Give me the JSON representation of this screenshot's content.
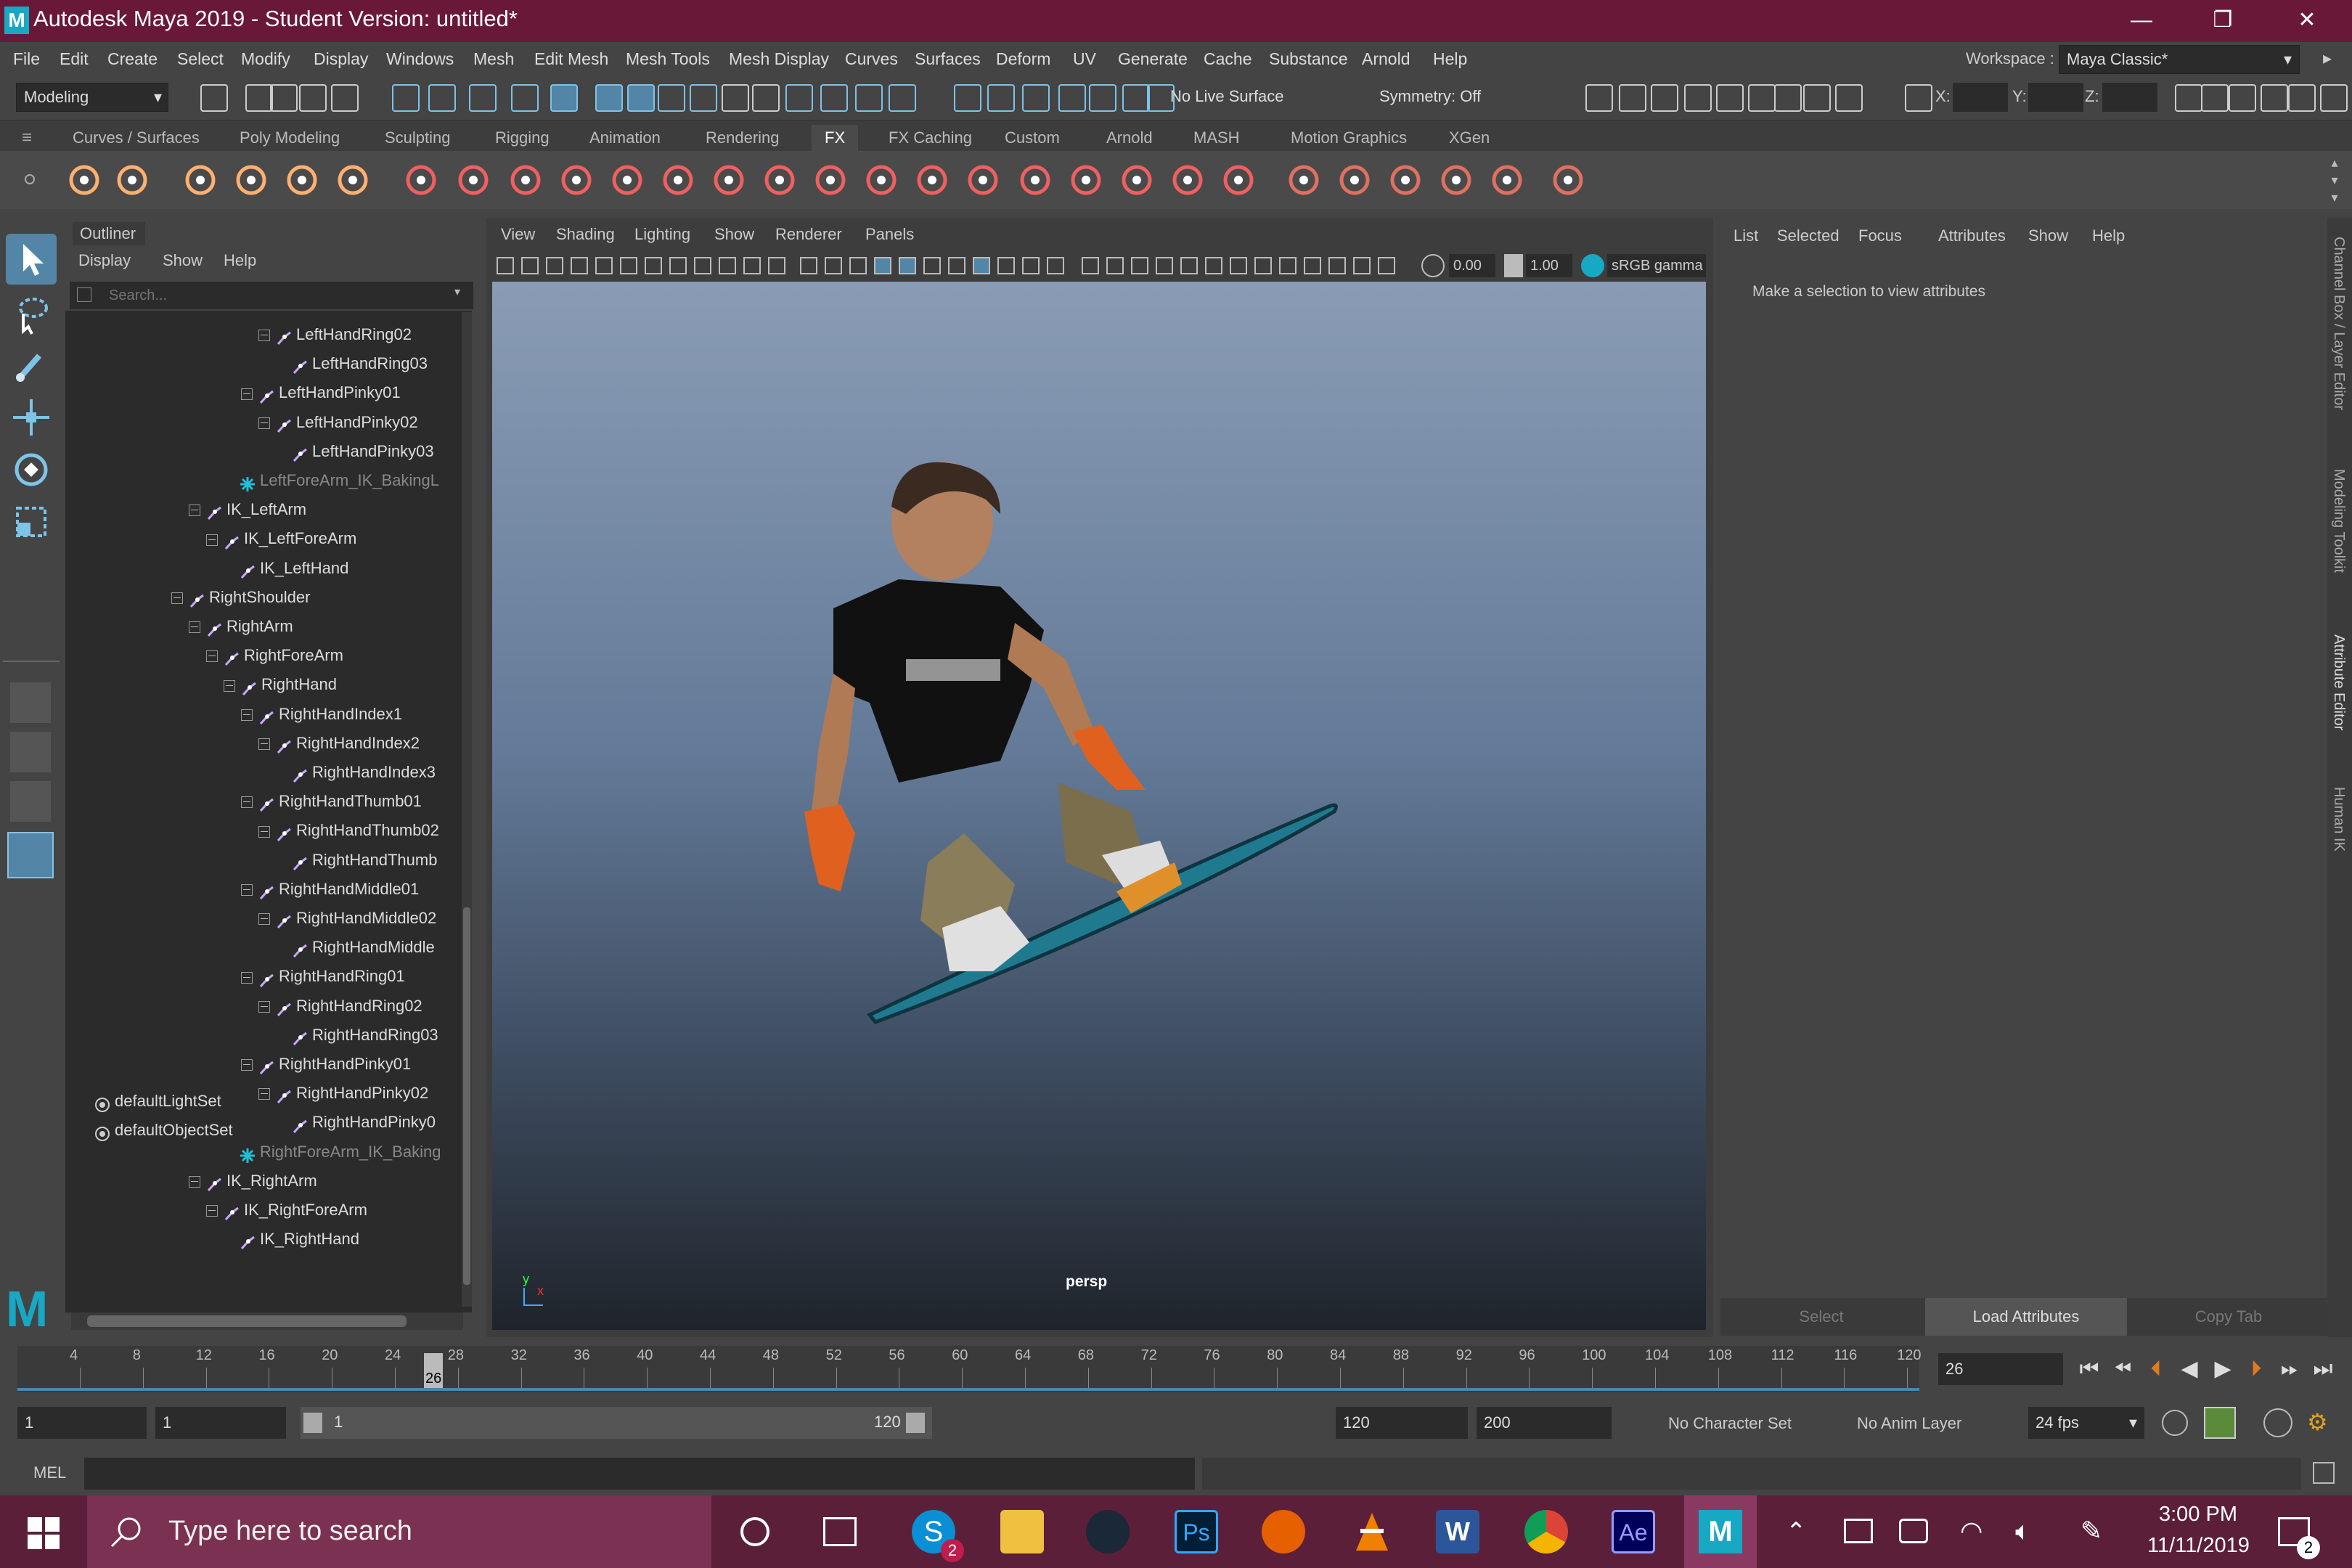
{
  "window": {
    "title": "Autodesk Maya 2019 - Student Version: untitled*",
    "minimize": "—",
    "restore": "❐",
    "close": "✕"
  },
  "menubar": {
    "items": [
      "File",
      "Edit",
      "Create",
      "Select",
      "Modify",
      "Display",
      "Windows",
      "Mesh",
      "Edit Mesh",
      "Mesh Tools",
      "Mesh Display",
      "Curves",
      "Surfaces",
      "Deform",
      "UV",
      "Generate",
      "Cache",
      "Substance",
      "Arnold",
      "Help"
    ],
    "workspace_label": "Workspace :",
    "workspace_value": "Maya Classic*"
  },
  "statusline": {
    "menuset": "Modeling",
    "live_surface": "No Live Surface",
    "symmetry": "Symmetry: Off",
    "x_label": "X:",
    "y_label": "Y:",
    "z_label": "Z:"
  },
  "shelf": {
    "tabs": [
      "Curves / Surfaces",
      "Poly Modeling",
      "Sculpting",
      "Rigging",
      "Animation",
      "Rendering",
      "FX",
      "FX Caching",
      "Custom",
      "Arnold",
      "MASH",
      "Motion Graphics",
      "XGen"
    ],
    "active_tab": "FX"
  },
  "outliner": {
    "title": "Outliner",
    "menu": [
      "Display",
      "Show",
      "Help"
    ],
    "search_placeholder": "Search...",
    "nodes": [
      {
        "label": "LeftHandRing02",
        "depth": 5,
        "expand": true
      },
      {
        "label": "LeftHandRing03",
        "depth": 6,
        "expand": false
      },
      {
        "label": "LeftHandPinky01",
        "depth": 4,
        "expand": true
      },
      {
        "label": "LeftHandPinky02",
        "depth": 5,
        "expand": true
      },
      {
        "label": "LeftHandPinky03",
        "depth": 6,
        "expand": false
      },
      {
        "label": "LeftForeArm_IK_BakingL",
        "depth": 3,
        "expand": false,
        "dim": true,
        "star": true
      },
      {
        "label": "IK_LeftArm",
        "depth": 1,
        "expand": true
      },
      {
        "label": "IK_LeftForeArm",
        "depth": 2,
        "expand": true
      },
      {
        "label": "IK_LeftHand",
        "depth": 3,
        "expand": false
      },
      {
        "label": "RightShoulder",
        "depth": 0,
        "expand": true
      },
      {
        "label": "RightArm",
        "depth": 1,
        "expand": true
      },
      {
        "label": "RightForeArm",
        "depth": 2,
        "expand": true
      },
      {
        "label": "RightHand",
        "depth": 3,
        "expand": true
      },
      {
        "label": "RightHandIndex1",
        "depth": 4,
        "expand": true
      },
      {
        "label": "RightHandIndex2",
        "depth": 5,
        "expand": true
      },
      {
        "label": "RightHandIndex3",
        "depth": 6,
        "expand": false
      },
      {
        "label": "RightHandThumb01",
        "depth": 4,
        "expand": true
      },
      {
        "label": "RightHandThumb02",
        "depth": 5,
        "expand": true
      },
      {
        "label": "RightHandThumb",
        "depth": 6,
        "expand": false
      },
      {
        "label": "RightHandMiddle01",
        "depth": 4,
        "expand": true
      },
      {
        "label": "RightHandMiddle02",
        "depth": 5,
        "expand": true
      },
      {
        "label": "RightHandMiddle",
        "depth": 6,
        "expand": false
      },
      {
        "label": "RightHandRing01",
        "depth": 4,
        "expand": true
      },
      {
        "label": "RightHandRing02",
        "depth": 5,
        "expand": true
      },
      {
        "label": "RightHandRing03",
        "depth": 6,
        "expand": false
      },
      {
        "label": "RightHandPinky01",
        "depth": 4,
        "expand": true
      },
      {
        "label": "RightHandPinky02",
        "depth": 5,
        "expand": true
      },
      {
        "label": "RightHandPinky0",
        "depth": 6,
        "expand": false
      },
      {
        "label": "RightForeArm_IK_Baking",
        "depth": 3,
        "expand": false,
        "dim": true,
        "star": true
      },
      {
        "label": "IK_RightArm",
        "depth": 1,
        "expand": true
      },
      {
        "label": "IK_RightForeArm",
        "depth": 2,
        "expand": true
      },
      {
        "label": "IK_RightHand",
        "depth": 3,
        "expand": false
      },
      {
        "label": "defaultLightSet",
        "depth": -3,
        "expand": false,
        "set": true
      },
      {
        "label": "defaultObjectSet",
        "depth": -3,
        "expand": false,
        "set": true
      }
    ]
  },
  "viewport": {
    "menu": [
      "View",
      "Shading",
      "Lighting",
      "Show",
      "Renderer",
      "Panels"
    ],
    "exposure": "0.00",
    "gamma": "1.00",
    "colorspace": "sRGB gamma",
    "camera": "persp",
    "axis_y": "y",
    "axis_x": "x"
  },
  "attribute_editor": {
    "menu": [
      "List",
      "Selected",
      "Focus",
      "Attributes",
      "Show",
      "Help"
    ],
    "message": "Make a selection to view attributes",
    "buttons": [
      "Select",
      "Load Attributes",
      "Copy Tab"
    ]
  },
  "side_tabs": [
    "Channel Box / Layer Editor",
    "Modeling Toolkit",
    "Attribute Editor",
    "Human IK"
  ],
  "timeline": {
    "ticks": [
      "4",
      "8",
      "12",
      "16",
      "20",
      "24",
      "28",
      "32",
      "36",
      "40",
      "44",
      "48",
      "52",
      "56",
      "60",
      "64",
      "68",
      "72",
      "76",
      "80",
      "84",
      "88",
      "92",
      "96",
      "100",
      "104",
      "108",
      "112",
      "116",
      "120"
    ],
    "current_frame": "26",
    "current_field": "26"
  },
  "range": {
    "start": "1",
    "playback_start": "1",
    "slider_start": "1",
    "slider_end": "120",
    "playback_end": "120",
    "end": "200",
    "character_set": "No Character Set",
    "anim_layer": "No Anim Layer",
    "fps": "24 fps"
  },
  "cmdline": {
    "label": "MEL"
  },
  "taskbar": {
    "search_placeholder": "Type here to search",
    "time": "3:00 PM",
    "date": "11/11/2019",
    "skype_badge": "2",
    "notif_badge": "2"
  },
  "colors": {
    "title": "#6a1838",
    "taskbar": "#5c1f3a",
    "accent": "#5285a6",
    "joint": "#c8a8ff"
  }
}
